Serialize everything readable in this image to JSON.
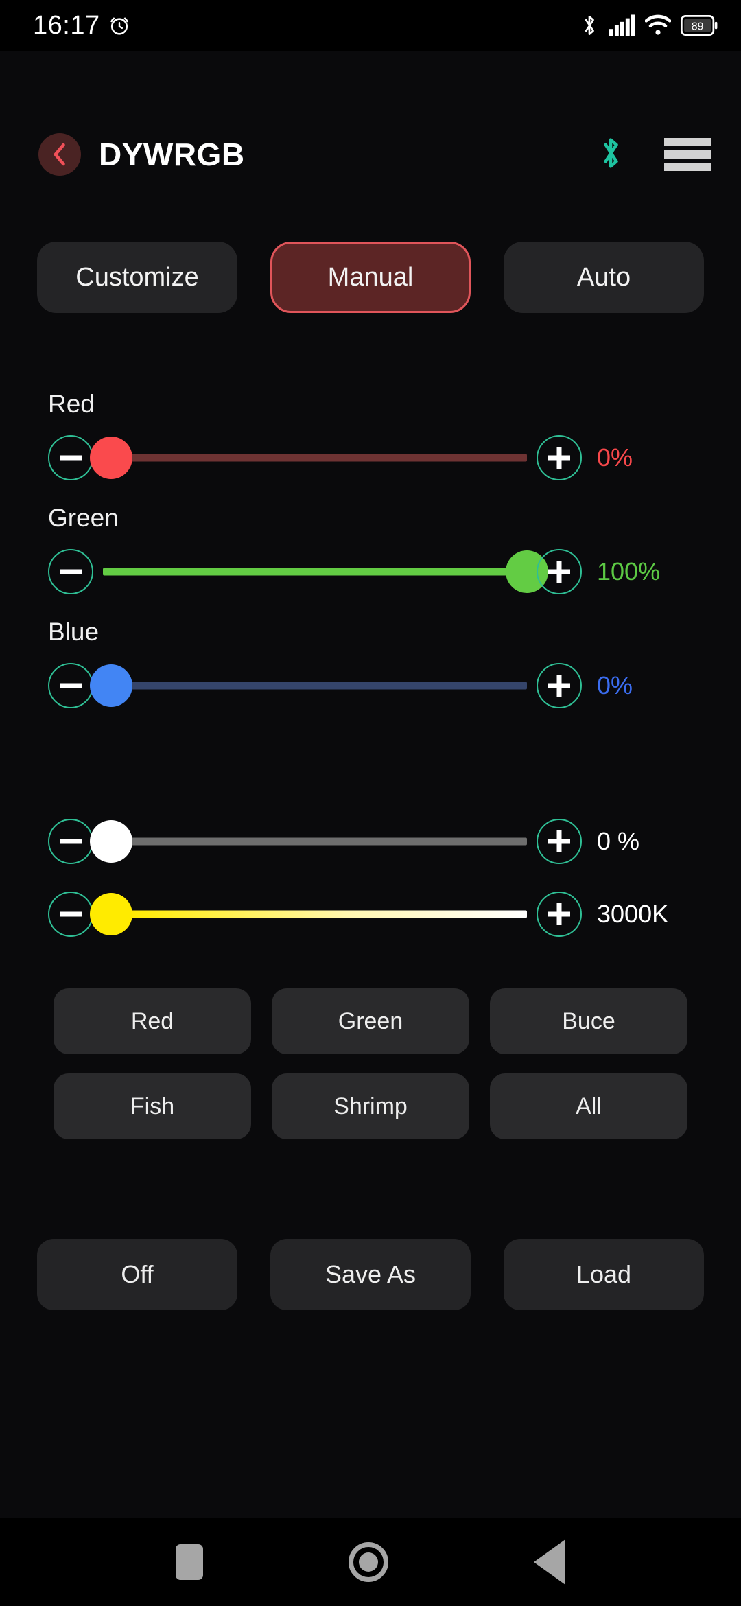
{
  "status_bar": {
    "time": "16:17",
    "alarm_icon": "alarm-clock-icon",
    "bluetooth_icon": "bluetooth-icon",
    "signal_icon": "cellular-signal-icon",
    "wifi_icon": "wifi-icon",
    "battery_level": "89"
  },
  "header": {
    "back_icon": "chevron-left-icon",
    "title": "DYWRGB",
    "bluetooth_icon": "bluetooth-icon",
    "menu_icon": "hamburger-menu-icon",
    "accent_bluetooth": "#1ec3a0",
    "back_bg": "#4a2323",
    "back_arrow_color": "#f05058"
  },
  "tabs": [
    {
      "label": "Customize",
      "active": false
    },
    {
      "label": "Manual",
      "active": true
    },
    {
      "label": "Auto",
      "active": false
    }
  ],
  "tab_colors": {
    "inactive_bg": "#242426",
    "active_bg": "#5c2525",
    "active_border": "#e0555a"
  },
  "rgb_sliders": [
    {
      "label": "Red",
      "value": "0%",
      "percent": 0,
      "thumb_color": "#fa4a4d",
      "track_color": "#6e3333",
      "value_color": "#f8484b",
      "minus_icon": "minus-icon",
      "plus_icon": "plus-icon"
    },
    {
      "label": "Green",
      "value": "100%",
      "percent": 100,
      "thumb_color": "#63cc44",
      "track_color": "#63cc44",
      "value_color": "#5cc944",
      "minus_icon": "minus-icon",
      "plus_icon": "plus-icon"
    },
    {
      "label": "Blue",
      "value": "0%",
      "percent": 0,
      "thumb_color": "#4285f4",
      "track_color": "#35456b",
      "value_color": "#3b6df0",
      "minus_icon": "minus-icon",
      "plus_icon": "plus-icon"
    }
  ],
  "extra_sliders": [
    {
      "label": "",
      "value": "0 %",
      "percent": 0,
      "thumb_color": "#ffffff",
      "track_color": "#6e6e6e",
      "value_color": "#ffffff",
      "minus_icon": "minus-icon",
      "plus_icon": "plus-icon"
    },
    {
      "label": "",
      "value": "3000K",
      "percent": 0,
      "thumb_color": "#ffeb00",
      "track_color": "gradient-yellow-white",
      "value_color": "#ffffff",
      "minus_icon": "minus-icon",
      "plus_icon": "plus-icon"
    }
  ],
  "presets": [
    {
      "label": "Red"
    },
    {
      "label": "Green"
    },
    {
      "label": "Buce"
    },
    {
      "label": "Fish"
    },
    {
      "label": "Shrimp"
    },
    {
      "label": "All"
    }
  ],
  "actions": [
    {
      "label": "Off"
    },
    {
      "label": "Save As"
    },
    {
      "label": "Load"
    }
  ],
  "nav_bar": {
    "recents_icon": "square-recents-icon",
    "home_icon": "circle-home-icon",
    "back_icon": "triangle-back-icon"
  },
  "theme": {
    "background": "#0a0a0c",
    "accent_teal": "#2fbf95",
    "surface": "#242426",
    "preset_surface": "#2a2a2c"
  }
}
